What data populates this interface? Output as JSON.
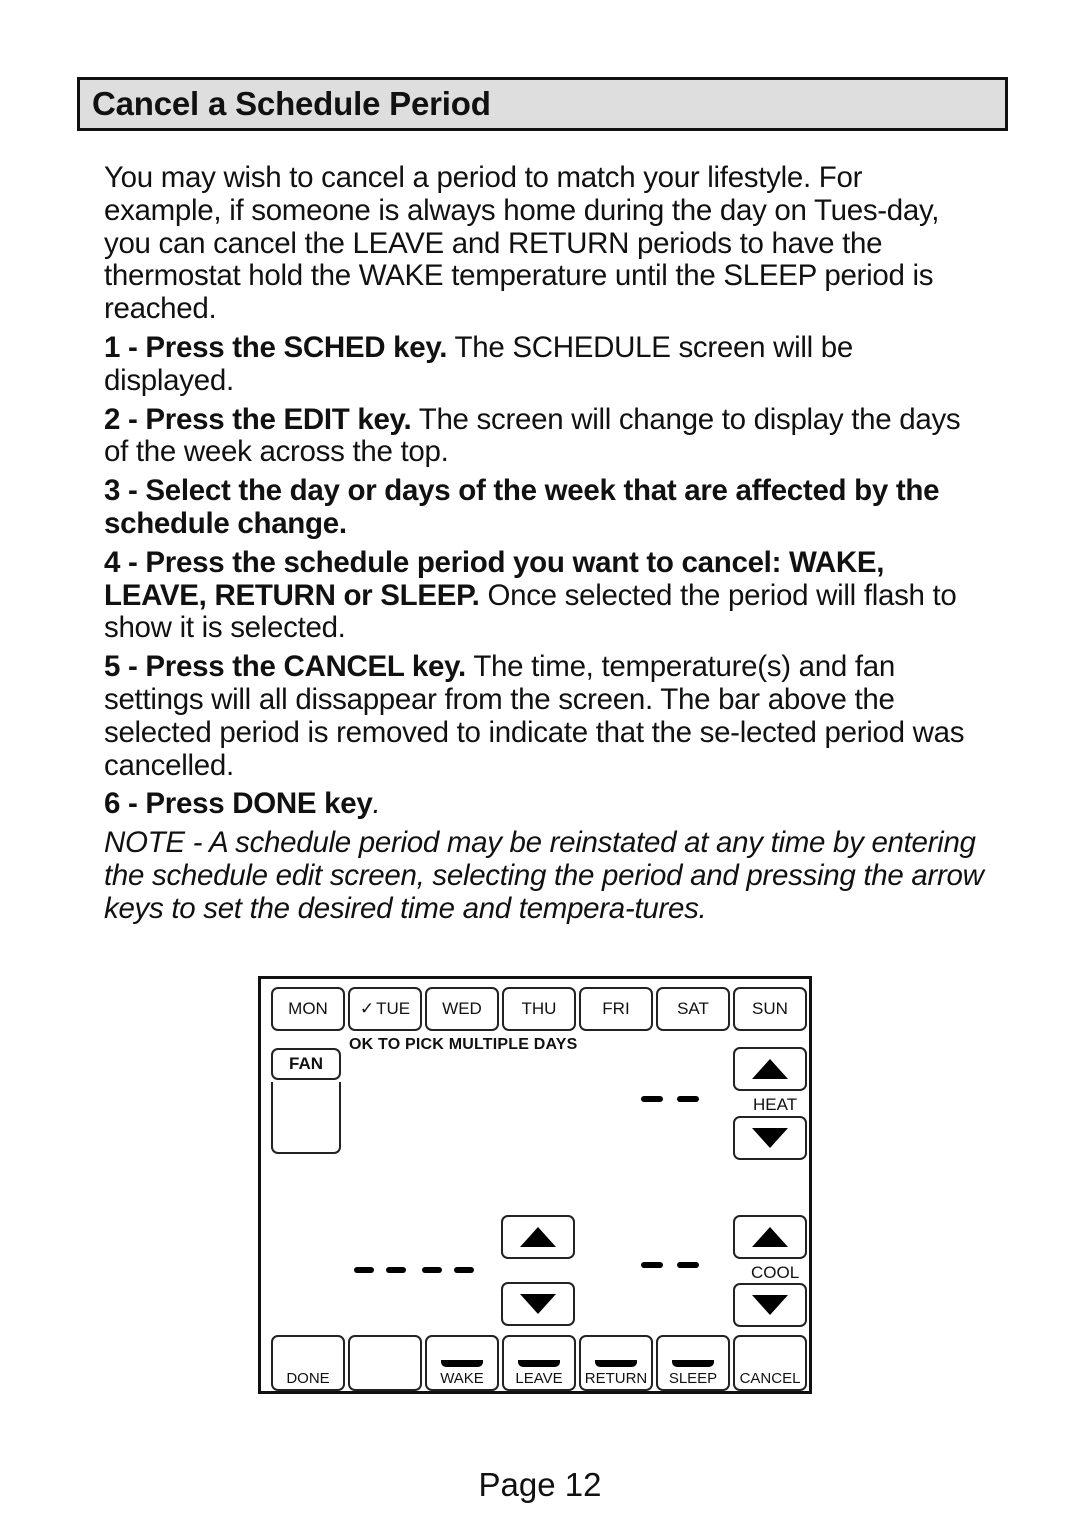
{
  "section_title": "Cancel a Schedule Period",
  "intro": "You may wish to cancel a period to match your lifestyle. For example, if someone is always home during the day on Tues-day, you can cancel the LEAVE and RETURN periods to have the thermostat hold the WAKE temperature until the SLEEP period is reached.",
  "steps": [
    {
      "bold": "1 - Press the SCHED key.",
      "text": " The SCHEDULE screen will be displayed."
    },
    {
      "bold": "2 - Press the EDIT key.",
      "text": " The screen will change to display the days of the week across the top."
    },
    {
      "bold": "3 - Select the day or days of the week that are affected by the schedule change.",
      "text": ""
    },
    {
      "bold": "4 - Press the schedule  period you want to cancel: WAKE, LEAVE, RETURN or SLEEP.",
      "text": " Once selected the period will flash to show it is selected."
    },
    {
      "bold": "5 - Press the CANCEL key.",
      "text": " The time, temperature(s) and fan settings will all dissappear from the screen. The bar above the selected period is removed to indicate that the se-lected period was cancelled."
    },
    {
      "bold": "6 - Press DONE key",
      "text": "."
    }
  ],
  "note": "NOTE - A schedule period may be reinstated at any time by entering the schedule edit screen, selecting the period and pressing the arrow keys to set the desired time and tempera-tures.",
  "thermostat": {
    "days": [
      {
        "label": "MON",
        "checked": false
      },
      {
        "label": "TUE",
        "checked": true,
        "check_glyph": "✓"
      },
      {
        "label": "WED",
        "checked": false
      },
      {
        "label": "THU",
        "checked": false
      },
      {
        "label": "FRI",
        "checked": false
      },
      {
        "label": "SAT",
        "checked": false
      },
      {
        "label": "SUN",
        "checked": false
      }
    ],
    "hint": "OK TO PICK MULTIPLE DAYS",
    "fan_label": "FAN",
    "heat_label": "HEAT",
    "cool_label": "COOL",
    "heat_display": "- -",
    "cool_display": "- -",
    "time_display": "- - - -",
    "bottom_keys": [
      {
        "label": "DONE",
        "bar": false
      },
      {
        "label": "",
        "bar": false
      },
      {
        "label": "WAKE",
        "bar": true
      },
      {
        "label": "LEAVE",
        "bar": true
      },
      {
        "label": "RETURN",
        "bar": true
      },
      {
        "label": "SLEEP",
        "bar": true
      },
      {
        "label": "CANCEL",
        "bar": false
      }
    ]
  },
  "page_label": "Page 12"
}
